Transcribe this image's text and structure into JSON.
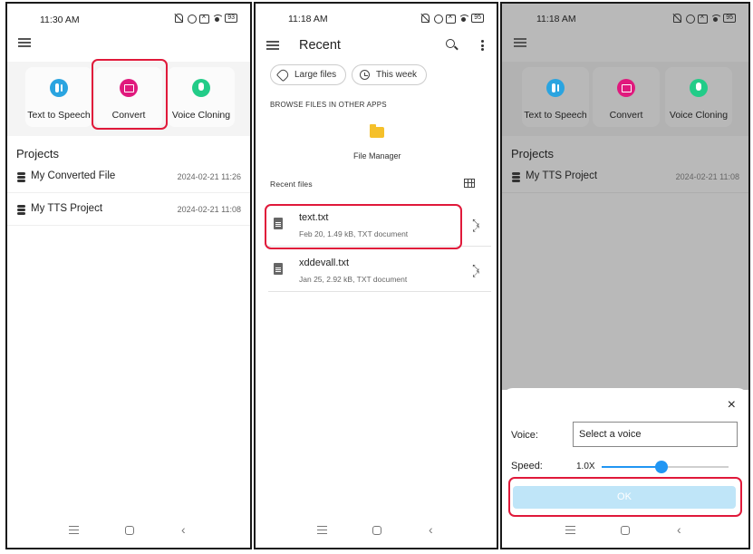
{
  "panel1": {
    "status": {
      "time": "11:30 AM",
      "battery": "93"
    },
    "cards": [
      {
        "label": "Text to Speech",
        "icon": "tts-icon"
      },
      {
        "label": "Convert",
        "icon": "convert-icon"
      },
      {
        "label": "Voice Cloning",
        "icon": "microphone-icon"
      }
    ],
    "projects_title": "Projects",
    "projects": [
      {
        "name": "My Converted File",
        "date": "2024-02-21 11:26"
      },
      {
        "name": "My TTS Project",
        "date": "2024-02-21 11:08"
      }
    ]
  },
  "panel2": {
    "status": {
      "time": "11:18 AM",
      "battery": "95"
    },
    "title": "Recent",
    "chips": [
      "Large files",
      "This week"
    ],
    "browse_label": "BROWSE FILES IN OTHER APPS",
    "file_manager_label": "File Manager",
    "recent_files_label": "Recent files",
    "files": [
      {
        "name": "text.txt",
        "meta": "Feb 20, 1.49 kB, TXT document"
      },
      {
        "name": "xddevall.txt",
        "meta": "Jan 25, 2.92 kB, TXT document"
      }
    ]
  },
  "panel3": {
    "status": {
      "time": "11:18 AM",
      "battery": "95"
    },
    "cards": [
      {
        "label": "Text to Speech"
      },
      {
        "label": "Convert"
      },
      {
        "label": "Voice Cloning"
      }
    ],
    "projects_title": "Projects",
    "projects": [
      {
        "name": "My TTS Project",
        "date": "2024-02-21 11:08"
      }
    ],
    "dialog": {
      "close_icon": "×",
      "voice_label": "Voice:",
      "voice_placeholder": "Select a voice",
      "speed_label": "Speed:",
      "speed_value": "1.0X",
      "speed_fraction": 0.47,
      "ok_label": "OK"
    }
  },
  "colors": {
    "highlight": "#e0193a",
    "tts": "#2aa4e0",
    "convert": "#e0197d",
    "clone": "#22cc88",
    "slider": "#2196f3",
    "ok_button": "#bfe5f8"
  }
}
